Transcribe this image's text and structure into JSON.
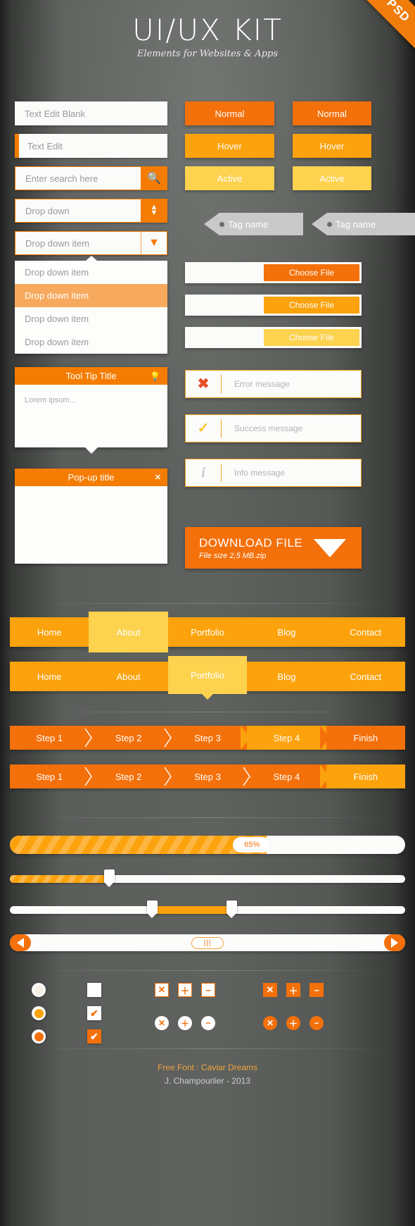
{
  "ribbon": {
    "label": "Free PSD"
  },
  "header": {
    "title": "UI/UX KIT",
    "subtitle": "Elements for Websites & Apps"
  },
  "forms": {
    "text_blank_placeholder": "Text Edit Blank",
    "text_edit_placeholder": "Text Edit",
    "search_placeholder": "Enter search here",
    "search_icon": "search-icon",
    "dropdown_value": "Drop down",
    "dropdown_spinner_icon": "updown-arrows-icon",
    "dropdown_item_value": "Drop down item",
    "dropdown_caret_icon": "chevron-down-icon",
    "dropdown_options": [
      {
        "label": "Drop down item",
        "selected": false
      },
      {
        "label": "Drop down item",
        "selected": true
      },
      {
        "label": "Drop down item",
        "selected": false
      },
      {
        "label": "Drop down item",
        "selected": false
      }
    ]
  },
  "tooltip": {
    "title": "Tool Tip Title",
    "icon": "lightbulb-icon",
    "body": "Lorem ipsum..."
  },
  "popup": {
    "title": "Pop-up title",
    "close_icon": "close-icon"
  },
  "buttons": {
    "states": [
      "Normal",
      "Hover",
      "Active"
    ],
    "colors": {
      "normal": "#f4700a",
      "hover": "#fca20c",
      "active": "#fcd24f"
    }
  },
  "tags": [
    {
      "label": "Tag name"
    },
    {
      "label": "Tag name"
    }
  ],
  "file_pickers": [
    {
      "label": "Choose File",
      "state": "normal"
    },
    {
      "label": "Choose File",
      "state": "hover"
    },
    {
      "label": "Choose File",
      "state": "active"
    }
  ],
  "alerts": [
    {
      "icon": "cross-icon",
      "text": "Error message",
      "type": "error",
      "color": "#e8502a"
    },
    {
      "icon": "check-icon",
      "text": "Success message",
      "type": "success",
      "color": "#fcc436"
    },
    {
      "icon": "info-icon",
      "text": "Info message",
      "type": "info",
      "color": "#c6c6c6"
    }
  ],
  "download": {
    "title": "DOWNLOAD FILE",
    "subtitle": "File size 2,5 MB.zip",
    "icon": "triangle-down-icon"
  },
  "navs": [
    {
      "items": [
        "Home",
        "About",
        "Portfolio",
        "Blog",
        "Contact"
      ],
      "selected": 1
    },
    {
      "items": [
        "Home",
        "About",
        "Portfolio",
        "Blog",
        "Contact"
      ],
      "selected": 2
    }
  ],
  "steps": [
    {
      "items": [
        "Step 1",
        "Step 2",
        "Step 3",
        "Step 4",
        "Finish"
      ],
      "selected": 3
    },
    {
      "items": [
        "Step 1",
        "Step 2",
        "Step 3",
        "Step 4",
        "Finish"
      ],
      "selected": 4
    }
  ],
  "progress": {
    "percent": 65,
    "label": "65%"
  },
  "sliders": [
    {
      "type": "single",
      "value": 25
    },
    {
      "type": "range",
      "from": 36,
      "to": 56
    }
  ],
  "scrollbar": {
    "left_icon": "arrow-left-icon",
    "right_icon": "arrow-right-icon",
    "grip_icon": "grip-lines-icon",
    "grip_label": "|||"
  },
  "controls": {
    "radios": [
      {
        "state": "empty",
        "fill": "#f7f0e4"
      },
      {
        "state": "hover",
        "fill": "#fca20c"
      },
      {
        "state": "checked",
        "fill": "#f4700a"
      }
    ],
    "checkboxes": [
      {
        "state": "empty",
        "glyph": ""
      },
      {
        "state": "checked",
        "glyph": "✔"
      },
      {
        "state": "filled",
        "glyph": "✔"
      }
    ],
    "square_buttons_left": [
      {
        "icon": "close-icon",
        "glyph": "✕",
        "filled": false
      },
      {
        "icon": "plus-icon",
        "glyph": "＋",
        "filled": false
      },
      {
        "icon": "minus-icon",
        "glyph": "−",
        "filled": false
      }
    ],
    "round_buttons_left": [
      {
        "icon": "close-circle-icon",
        "glyph": "✕",
        "filled": false
      },
      {
        "icon": "plus-circle-icon",
        "glyph": "＋",
        "filled": false
      },
      {
        "icon": "minus-circle-icon",
        "glyph": "−",
        "filled": false
      }
    ],
    "square_buttons_right": [
      {
        "icon": "close-icon",
        "glyph": "✕",
        "filled": true
      },
      {
        "icon": "plus-icon",
        "glyph": "＋",
        "filled": true
      },
      {
        "icon": "minus-icon",
        "glyph": "−",
        "filled": true
      }
    ],
    "round_buttons_right": [
      {
        "icon": "close-circle-icon",
        "glyph": "✕",
        "filled": true
      },
      {
        "icon": "plus-circle-icon",
        "glyph": "＋",
        "filled": true
      },
      {
        "icon": "minus-circle-icon",
        "glyph": "−",
        "filled": true
      }
    ]
  },
  "footer": {
    "line1": "Free Font : Caviar Dreams",
    "line2": "J. Champourlier - 2013"
  }
}
